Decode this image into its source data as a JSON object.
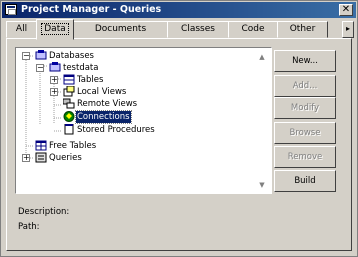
{
  "window": {
    "title": "Project Manager - Queries",
    "close_label": "✕"
  },
  "tabs": [
    {
      "label": "All",
      "active": false
    },
    {
      "label": "Data",
      "active": true
    },
    {
      "label": "Documents",
      "active": false
    },
    {
      "label": "Classes",
      "active": false
    },
    {
      "label": "Code",
      "active": false
    },
    {
      "label": "Other",
      "active": false
    }
  ],
  "tab_scroll_label": "▸",
  "tree": {
    "items": [
      {
        "label": "Databases",
        "icon": "database-icon",
        "expander": "−"
      },
      {
        "label": "testdata",
        "icon": "database-icon",
        "expander": "−"
      },
      {
        "label": "Tables",
        "icon": "table-icon",
        "expander": "+"
      },
      {
        "label": "Local Views",
        "icon": "local-view-icon",
        "expander": "+"
      },
      {
        "label": "Remote Views",
        "icon": "remote-view-icon",
        "expander": ""
      },
      {
        "label": "Connections",
        "icon": "connection-icon",
        "expander": "",
        "selected": true
      },
      {
        "label": "Stored Procedures",
        "icon": "stored-procedure-icon",
        "expander": ""
      },
      {
        "label": "Free Tables",
        "icon": "free-tables-icon",
        "expander": ""
      },
      {
        "label": "Queries",
        "icon": "queries-icon",
        "expander": "+"
      }
    ]
  },
  "buttons": {
    "new": "New...",
    "add": "Add...",
    "modify": "Modify",
    "browse": "Browse",
    "remove": "Remove",
    "build": "Build"
  },
  "info": {
    "description_label": "Description:",
    "path_label": "Path:"
  }
}
